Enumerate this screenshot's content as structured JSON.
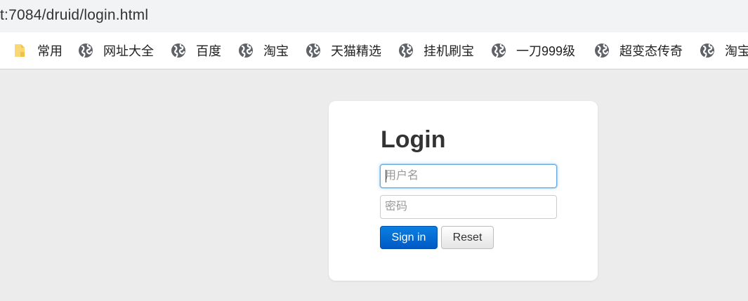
{
  "browser": {
    "url": "t:7084/druid/login.html"
  },
  "bookmarks": [
    {
      "label": "常用",
      "icon": "folder-icon"
    },
    {
      "label": "网址大全",
      "icon": "globe-icon"
    },
    {
      "label": "百度",
      "icon": "globe-icon"
    },
    {
      "label": "淘宝",
      "icon": "globe-icon"
    },
    {
      "label": "天猫精选",
      "icon": "globe-icon"
    },
    {
      "label": "挂机刷宝",
      "icon": "globe-icon"
    },
    {
      "label": "一刀999级",
      "icon": "globe-icon"
    },
    {
      "label": "超变态传奇",
      "icon": "globe-icon"
    },
    {
      "label": "淘宝",
      "icon": "globe-icon"
    }
  ],
  "login": {
    "title": "Login",
    "username": {
      "value": "",
      "placeholder": "用户名"
    },
    "password": {
      "value": "",
      "placeholder": "密码"
    },
    "signin_label": "Sign in",
    "reset_label": "Reset"
  },
  "colors": {
    "primary_button": "#0a6ed8",
    "page_background": "#ececec",
    "focus_border": "#68a8e0"
  }
}
